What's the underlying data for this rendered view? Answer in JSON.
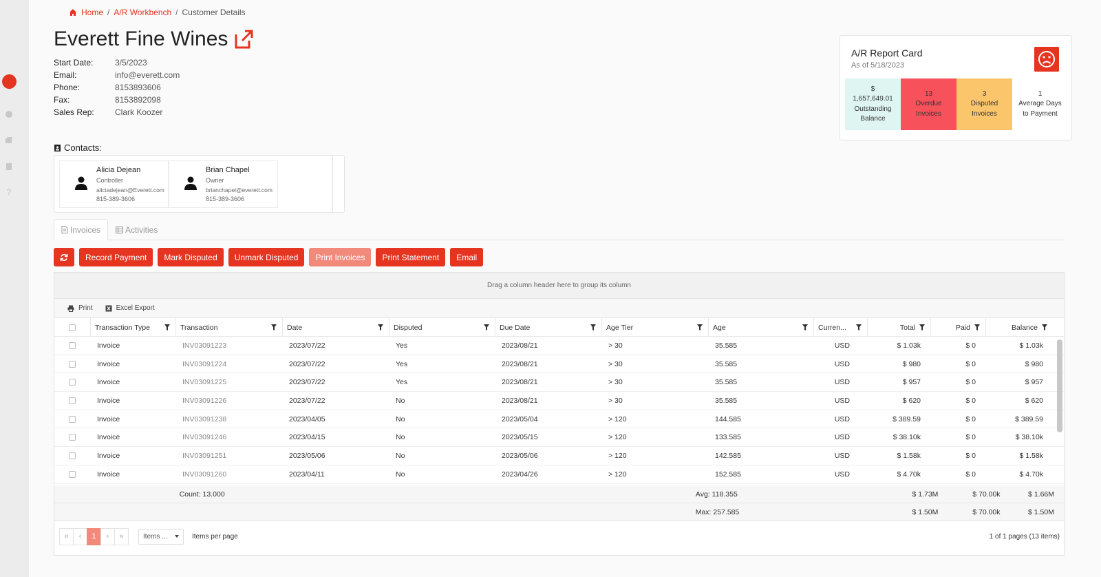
{
  "breadcrumb": {
    "home": "Home",
    "workbench": "A/R Workbench",
    "current": "Customer Details",
    "sep": "/"
  },
  "customer": {
    "name": "Everett Fine Wines",
    "start_date_label": "Start Date:",
    "start_date": "3/5/2023",
    "email_label": "Email:",
    "email": "info@everett.com",
    "phone_label": "Phone:",
    "phone": "8153893606",
    "fax_label": "Fax:",
    "fax": "8153892098",
    "rep_label": "Sales Rep:",
    "rep": "Clark Koozer"
  },
  "report_card": {
    "title": "A/R Report Card",
    "as_of": "As of 5/18/2023",
    "tiles": [
      {
        "lines": [
          "$",
          "1,657,649.01",
          "Outstanding",
          "Balance"
        ],
        "color": "#def5f1"
      },
      {
        "lines": [
          "13",
          "Overdue",
          "Invoices"
        ],
        "color": "#f7515c"
      },
      {
        "lines": [
          "3",
          "Disputed",
          "Invoices"
        ],
        "color": "#fbc66b"
      },
      {
        "lines": [
          "1",
          "Average Days",
          "to Payment"
        ],
        "color": "#ffffff"
      }
    ]
  },
  "contacts_label": "Contacts:",
  "contacts": [
    {
      "name": "Alicia Dejean",
      "role": "Controller",
      "email": "aliciadejean@Everett.com",
      "phone": "815-389-3606"
    },
    {
      "name": "Brian Chapel",
      "role": "Owner",
      "email": "brianchapel@everett.com",
      "phone": "815-389-3606"
    }
  ],
  "tabs": {
    "invoices": "Invoices",
    "activities": "Activities"
  },
  "toolbar": {
    "record_payment": "Record Payment",
    "mark_disputed": "Mark Disputed",
    "unmark_disputed": "Unmark Disputed",
    "print_invoices": "Print Invoices",
    "print_statement": "Print Statement",
    "email": "Email"
  },
  "grid": {
    "group_hint": "Drag a column header here to group its column",
    "print": "Print",
    "excel_export": "Excel Export",
    "columns": [
      "Transaction Type",
      "Transaction",
      "Date",
      "Disputed",
      "Due Date",
      "Age Tier",
      "Age",
      "Curren...",
      "Total",
      "Paid",
      "Balance"
    ],
    "rows": [
      [
        "Invoice",
        "INV03091223",
        "2023/07/22",
        "Yes",
        "2023/08/21",
        "> 30",
        "35.585",
        "USD",
        "$ 1.03k",
        "$ 0",
        "$ 1.03k"
      ],
      [
        "Invoice",
        "INV03091224",
        "2023/07/22",
        "Yes",
        "2023/08/21",
        "> 30",
        "35.585",
        "USD",
        "$ 980",
        "$ 0",
        "$ 980"
      ],
      [
        "Invoice",
        "INV03091225",
        "2023/07/22",
        "Yes",
        "2023/08/21",
        "> 30",
        "35.585",
        "USD",
        "$ 957",
        "$ 0",
        "$ 957"
      ],
      [
        "Invoice",
        "INV03091226",
        "2023/07/22",
        "No",
        "2023/08/21",
        "> 30",
        "35.585",
        "USD",
        "$ 620",
        "$ 0",
        "$ 620"
      ],
      [
        "Invoice",
        "INV03091238",
        "2023/04/05",
        "No",
        "2023/05/04",
        "> 120",
        "144.585",
        "USD",
        "$ 389.59",
        "$ 0",
        "$ 389.59"
      ],
      [
        "Invoice",
        "INV03091246",
        "2023/04/15",
        "No",
        "2023/05/15",
        "> 120",
        "133.585",
        "USD",
        "$ 38.10k",
        "$ 0",
        "$ 38.10k"
      ],
      [
        "Invoice",
        "INV03091251",
        "2023/05/06",
        "No",
        "2023/05/06",
        "> 120",
        "142.585",
        "USD",
        "$ 1.58k",
        "$ 0",
        "$ 1.58k"
      ],
      [
        "Invoice",
        "INV03091260",
        "2023/04/11",
        "No",
        "2023/04/26",
        "> 120",
        "152.585",
        "USD",
        "$ 4.70k",
        "$ 0",
        "$ 4.70k"
      ]
    ],
    "footer1": {
      "count": "Count: 13.000",
      "avg": "Avg: 118.355",
      "total": "$ 1.73M",
      "paid": "$ 70.00k",
      "balance": "$ 1.66M"
    },
    "footer2": {
      "max": "Max: 257.585",
      "total": "$ 1.50M",
      "paid": "$ 70.00k",
      "balance": "$ 1.50M"
    }
  },
  "pager": {
    "first": "«",
    "prev": "‹",
    "page": "1",
    "next": "›",
    "last": "»",
    "items_select": "Items ...",
    "items_label": "Items per page",
    "info": "1 of 1 pages (13 items)"
  }
}
